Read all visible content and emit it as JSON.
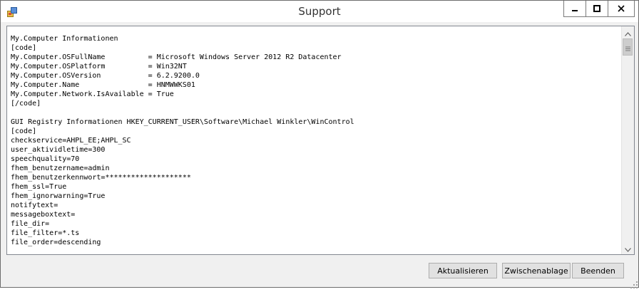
{
  "window": {
    "title": "Support",
    "controls": {
      "minimize": "minimize-icon",
      "maximize": "maximize-icon",
      "close": "close-icon"
    }
  },
  "content": {
    "text": "My.Computer Informationen\n[code]\nMy.Computer.OSFullName          = Microsoft Windows Server 2012 R2 Datacenter\nMy.Computer.OSPlatform          = Win32NT\nMy.Computer.OSVersion           = 6.2.9200.0\nMy.Computer.Name                = HNMWWKS01\nMy.Computer.Network.IsAvailable = True\n[/code]\n\nGUI Registry Informationen HKEY_CURRENT_USER\\Software\\Michael Winkler\\WinControl\n[code]\ncheckservice=AHPL_EE;AHPL_SC\nuser_aktividletime=300\nspeechquality=70\nfhem_benutzername=admin\nfhem_benutzerkennwort=********************\nfhem_ssl=True\nfhem_ignorwarning=True\nnotifytext=\nmessageboxtext=\nfile_dir=\nfile_filter=*.ts\nfile_order=descending"
  },
  "buttons": {
    "refresh": "Aktualisieren",
    "clipboard": "Zwischenablage",
    "exit": "Beenden"
  },
  "colors": {
    "window_border": "#6d6d6d",
    "client_background": "#f0f0f0",
    "button_background": "#e1e1e1",
    "button_border": "#adadad"
  }
}
